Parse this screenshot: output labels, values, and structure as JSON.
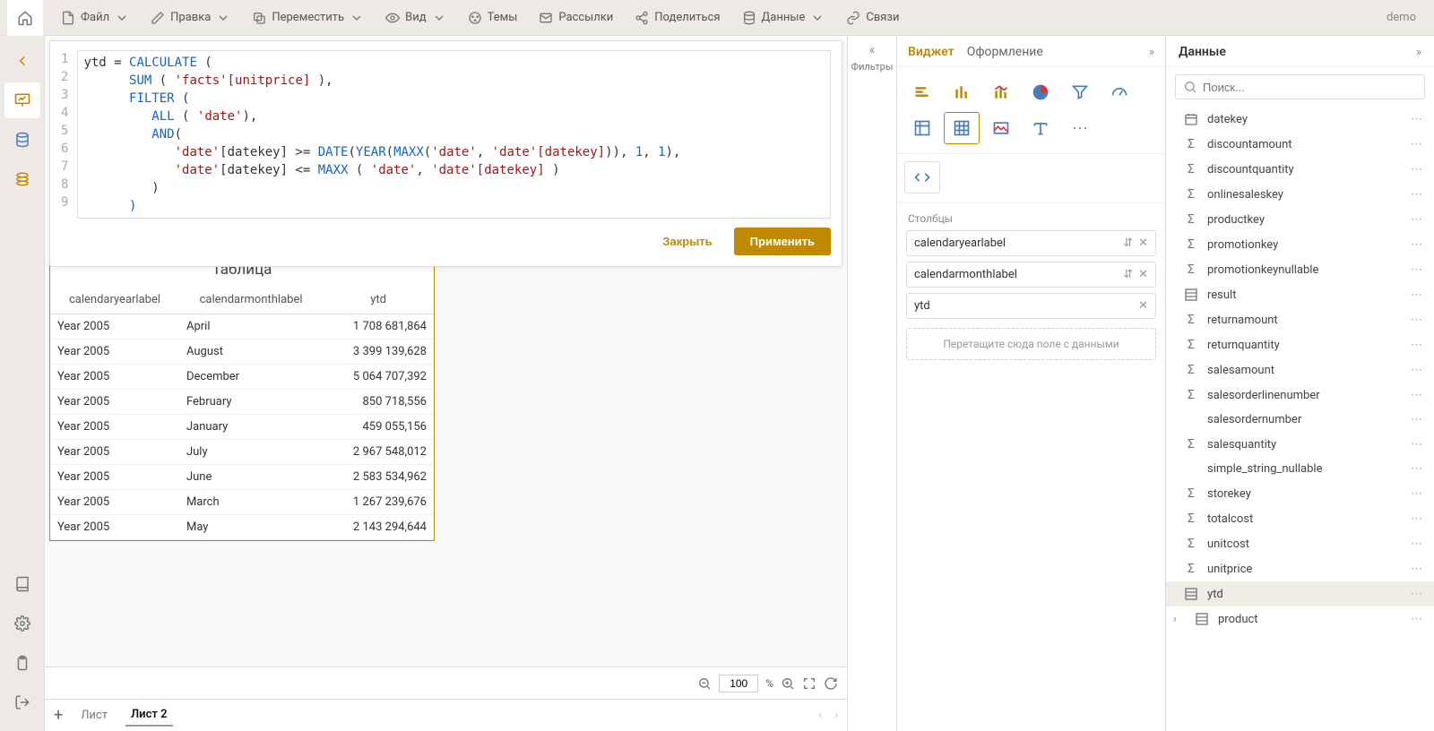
{
  "user_label": "demo",
  "menu": {
    "file": "Файл",
    "edit": "Правка",
    "move": "Переместить",
    "view": "Вид",
    "themes": "Темы",
    "mailings": "Рассылки",
    "share": "Поделиться",
    "data": "Данные",
    "links": "Связи"
  },
  "filters_label": "Фильтры",
  "editor": {
    "line_numbers": [
      "1",
      "2",
      "3",
      "4",
      "5",
      "6",
      "7",
      "8",
      "9"
    ],
    "close": "Закрыть",
    "apply": "Применить",
    "tokens": {
      "ytd_eq": "ytd = ",
      "calculate": "CALCULATE",
      "sum": "SUM",
      "filter": "FILTER",
      "all": "ALL",
      "and": "AND",
      "date_q": "'date'",
      "datekey_br": "[datekey]",
      "facts_unitprice": "'facts'[unitprice]",
      "date_fn": "DATE",
      "year_fn": "YEAR",
      "maxx": "MAXX",
      "one": "1",
      "dq1": "'date'",
      "dq2": "'date'[datekey]"
    }
  },
  "table": {
    "title": "Таблица",
    "headers": [
      "calendaryearlabel",
      "calendarmonthlabel",
      "ytd"
    ],
    "rows": [
      [
        "Year 2005",
        "April",
        "1 708 681,864"
      ],
      [
        "Year 2005",
        "August",
        "3 399 139,628"
      ],
      [
        "Year 2005",
        "December",
        "5 064 707,392"
      ],
      [
        "Year 2005",
        "February",
        "850 718,556"
      ],
      [
        "Year 2005",
        "January",
        "459 055,156"
      ],
      [
        "Year 2005",
        "July",
        "2 967 548,012"
      ],
      [
        "Year 2005",
        "June",
        "2 583 534,962"
      ],
      [
        "Year 2005",
        "March",
        "1 267 239,676"
      ],
      [
        "Year 2005",
        "May",
        "2 143 294,644"
      ]
    ]
  },
  "zoom_value": "100",
  "zoom_suffix": "%",
  "sheets": {
    "s1": "Лист",
    "s2": "Лист 2"
  },
  "widget_panel": {
    "tab_widget": "Виджет",
    "tab_style": "Оформление",
    "columns_label": "Столбцы",
    "pills": [
      "calendaryearlabel",
      "calendarmonthlabel",
      "ytd"
    ],
    "dropzone": "Перетащите сюда поле с данными"
  },
  "data_panel": {
    "title": "Данные",
    "search_placeholder": "Поиск...",
    "fields": [
      {
        "icon": "date",
        "name": "datekey"
      },
      {
        "icon": "sum",
        "name": "discountamount"
      },
      {
        "icon": "sum",
        "name": "discountquantity"
      },
      {
        "icon": "sum",
        "name": "onlinesaleskey"
      },
      {
        "icon": "sum",
        "name": "productkey"
      },
      {
        "icon": "sum",
        "name": "promotionkey"
      },
      {
        "icon": "sum",
        "name": "promotionkeynullable"
      },
      {
        "icon": "table",
        "name": "result"
      },
      {
        "icon": "sum",
        "name": "returnamount"
      },
      {
        "icon": "sum",
        "name": "returnquantity"
      },
      {
        "icon": "sum",
        "name": "salesamount"
      },
      {
        "icon": "sum",
        "name": "salesorderlinenumber"
      },
      {
        "icon": "none",
        "name": "salesordernumber"
      },
      {
        "icon": "sum",
        "name": "salesquantity"
      },
      {
        "icon": "none",
        "name": "simple_string_nullable"
      },
      {
        "icon": "sum",
        "name": "storekey"
      },
      {
        "icon": "sum",
        "name": "totalcost"
      },
      {
        "icon": "sum",
        "name": "unitcost"
      },
      {
        "icon": "sum",
        "name": "unitprice"
      },
      {
        "icon": "table",
        "name": "ytd",
        "selected": true
      }
    ],
    "group": {
      "name": "product"
    }
  }
}
